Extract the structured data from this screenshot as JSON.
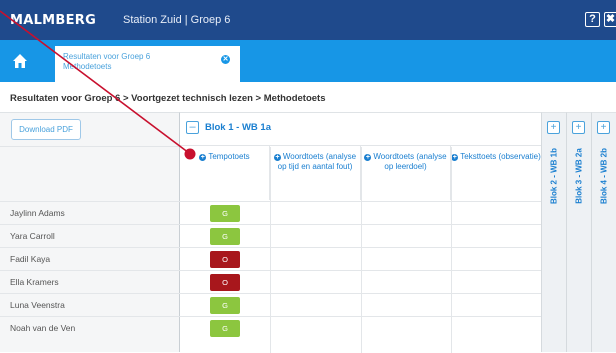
{
  "header": {
    "logo": "MALMBERG",
    "context": "Station Zuid  |  Groep 6",
    "help_label": "?",
    "close_label": "✖"
  },
  "tabs": [
    {
      "label": "Resultaten voor Groep 6 Methodetoets"
    }
  ],
  "breadcrumb": "Resultaten voor Groep 6 > Voortgezet technisch lezen > Methodetoets",
  "download_label": "Download PDF",
  "blok": {
    "title": "Blok 1 - WB 1a",
    "columns": [
      {
        "label": "Tempotoets"
      },
      {
        "label": "Woordtoets (analyse op tijd en aantal fout)"
      },
      {
        "label": "Woordtoets (analyse op leerdoel)"
      },
      {
        "label": "Teksttoets (observatie)"
      }
    ]
  },
  "collapsed_bloks": [
    "Blok 2 - WB 1b",
    "Blok 3 - WB 2a",
    "Blok 4 - WB 2b"
  ],
  "students": [
    {
      "name": "Jaylinn Adams",
      "score": "G"
    },
    {
      "name": "Yara Carroll",
      "score": "G"
    },
    {
      "name": "Fadil Kaya",
      "score": "O"
    },
    {
      "name": "Ella Kramers",
      "score": "O"
    },
    {
      "name": "Luna Veenstra",
      "score": "G"
    },
    {
      "name": "Noah van de Ven",
      "score": "G"
    }
  ],
  "colors": {
    "header_bg": "#1f4a8c",
    "tabbar_bg": "#1796e6",
    "accent": "#1a7fd0",
    "good": "#8cc63f",
    "insufficient": "#a8171c",
    "annotation": "#c8102e"
  },
  "icons": {
    "home": "home-icon",
    "close": "close-icon",
    "help": "help-icon"
  }
}
